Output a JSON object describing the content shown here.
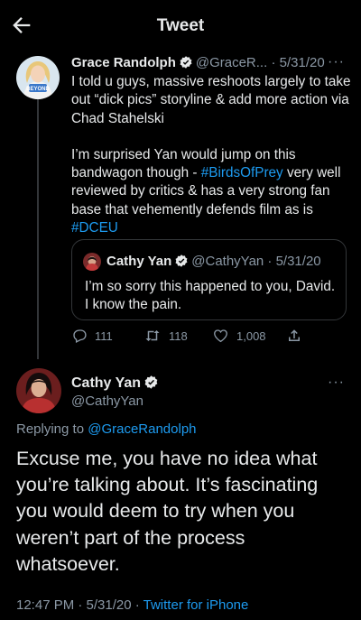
{
  "header": {
    "title": "Tweet",
    "back_icon": "arrow-left-icon"
  },
  "colors": {
    "background": "#000000",
    "text": "#e7e9ea",
    "muted": "#8b98a5",
    "link": "#1d9bf0",
    "border": "#333639"
  },
  "tweet1": {
    "name": "Grace Randolph",
    "handle": "@GraceR...",
    "date": "5/31/20",
    "more": "···",
    "body_line1": "I told u guys, massive reshoots largely to take out “dick pics” storyline & add more action via Chad Stahelski",
    "body_p2_text1": "I’m surprised Yan would jump on this bandwagon though - ",
    "hashtag1": "#BirdsOfPrey",
    "body_p2_text2": " very well reviewed by critics & has a very strong fan base that vehemently defends film as is ",
    "hashtag2": "#DCEU",
    "avatar_badge": "BEYOND",
    "quote": {
      "name": "Cathy Yan",
      "handle_date": "@CathyYan · 5/31/20",
      "body": "I’m so sorry this happened to you, David. I know the pain."
    },
    "actions": {
      "replies": "111",
      "retweets": "118",
      "likes": "1,008"
    }
  },
  "tweet2": {
    "name": "Cathy Yan",
    "handle": "@CathyYan",
    "more": "···",
    "replying_label": "Replying to ",
    "replying_handle": "@GraceRandolph",
    "body": "Excuse me, you have no idea what you’re talking about. It’s fascinating you would deem to try when you weren’t part of the process whatsoever.",
    "time": "12:47 PM · 5/31/20 · ",
    "source": "Twitter for iPhone"
  }
}
